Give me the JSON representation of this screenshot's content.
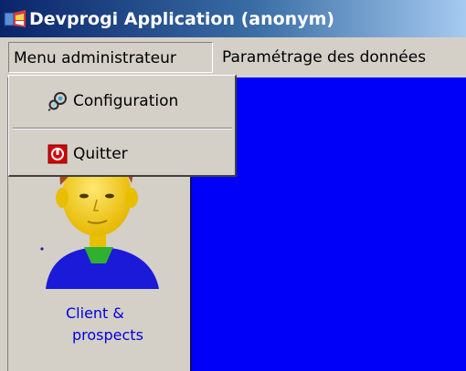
{
  "window": {
    "title": "Devprogi Application (anonym)"
  },
  "menubar": {
    "items": [
      {
        "label": "Menu administrateur",
        "state": "open"
      },
      {
        "label": "Paramétrage des données"
      }
    ]
  },
  "admin_menu": {
    "items": [
      {
        "label": "Configuration",
        "icon": "gears-icon"
      },
      {
        "label": "Quitter",
        "icon": "power-icon"
      }
    ]
  },
  "sidebar": {
    "modules": [
      {
        "label_lines": [
          "Client &",
          "prospects"
        ],
        "icon": "person-avatar-icon"
      }
    ]
  },
  "colors": {
    "workspace": "#0000fa",
    "module_label": "#0000e0",
    "titlebar_start": "#0a246a",
    "quit_icon": "#d40000"
  }
}
